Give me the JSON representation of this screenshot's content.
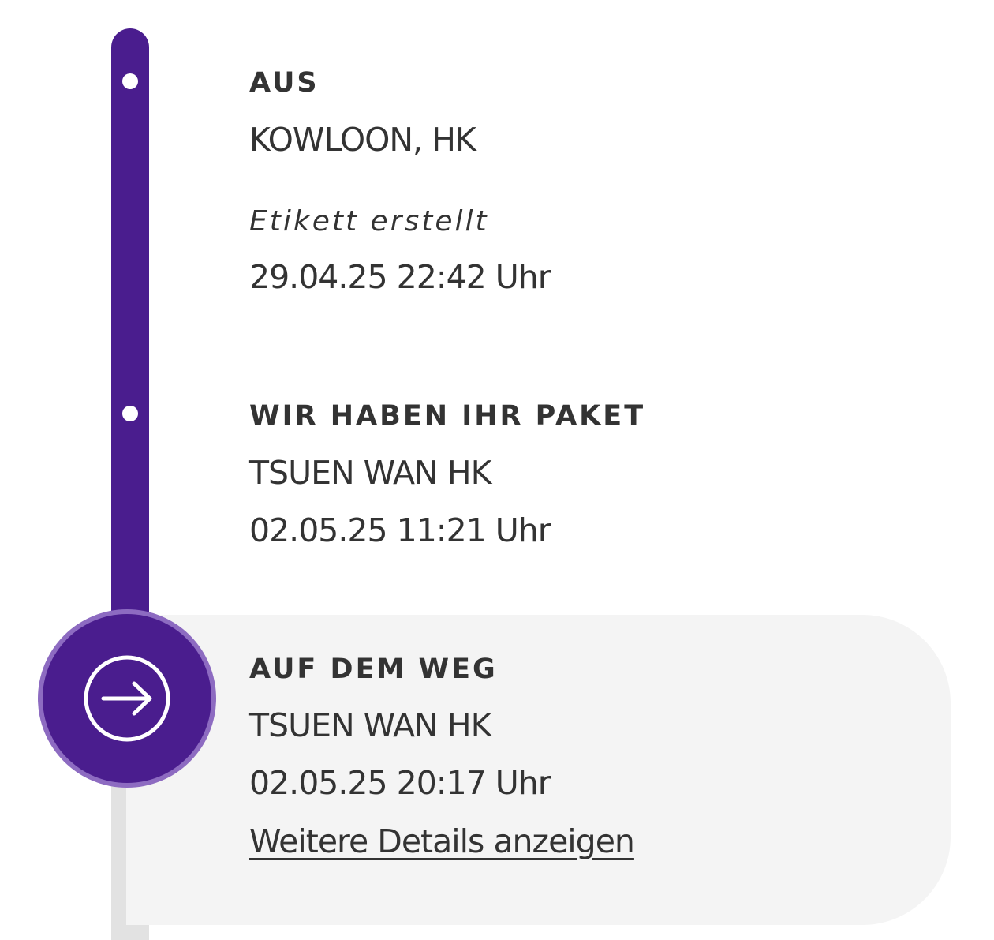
{
  "timeline": {
    "colors": {
      "track_active": "#4a1d8e",
      "track_inactive": "#e2e2e2",
      "current_ring": "#8d6bc1",
      "current_card_bg": "#f4f4f4"
    },
    "events": [
      {
        "heading": "AUS",
        "location": "KOWLOON, HK",
        "status": "Etikett erstellt",
        "datetime": "29.04.25 22:42 Uhr"
      },
      {
        "heading": "WIR HABEN IHR PAKET",
        "location": "TSUEN WAN HK",
        "datetime": "02.05.25 11:21 Uhr"
      },
      {
        "heading": "AUF DEM WEG",
        "location": "TSUEN WAN HK",
        "datetime": "02.05.25 20:17 Uhr",
        "link_label": "Weitere Details anzeigen",
        "current": true,
        "icon": "arrow-right-circle-icon"
      }
    ]
  }
}
